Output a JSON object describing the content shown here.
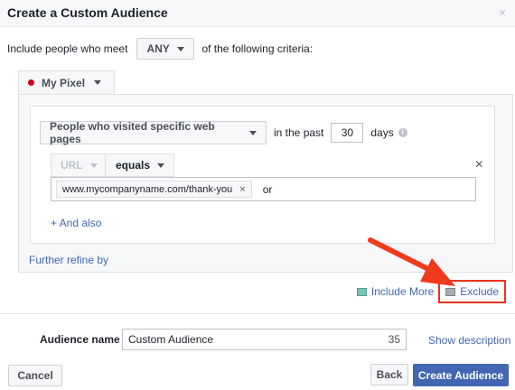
{
  "dialog": {
    "title": "Create a Custom Audience",
    "close_icon": "×"
  },
  "criteria": {
    "prefix": "Include people who meet",
    "match_mode": "ANY",
    "suffix": "of the following criteria:"
  },
  "source": {
    "name": "My Pixel",
    "status_color": "#d0021b"
  },
  "rule": {
    "visitor_type": "People who visited specific web pages",
    "in_the_past": "in the past",
    "days_value": "30",
    "days_label": "days",
    "info_icon": "i",
    "field": "URL",
    "operator": "equals",
    "remove_icon": "×",
    "token_value": "www.mycompanyname.com/thank-you",
    "token_remove": "×",
    "or_label": "or",
    "and_also": "+ And also"
  },
  "further_refine": "Further refine by",
  "actions": {
    "include_more": "Include More",
    "exclude": "Exclude",
    "highlight_color": "#e8331d"
  },
  "audience": {
    "label": "Audience name",
    "value": "Custom Audience",
    "remaining_chars": "35",
    "show_description": "Show description"
  },
  "footer": {
    "cancel": "Cancel",
    "back": "Back",
    "create": "Create Audience"
  },
  "colors": {
    "link": "#4267b2",
    "primary": "#4267b2"
  }
}
